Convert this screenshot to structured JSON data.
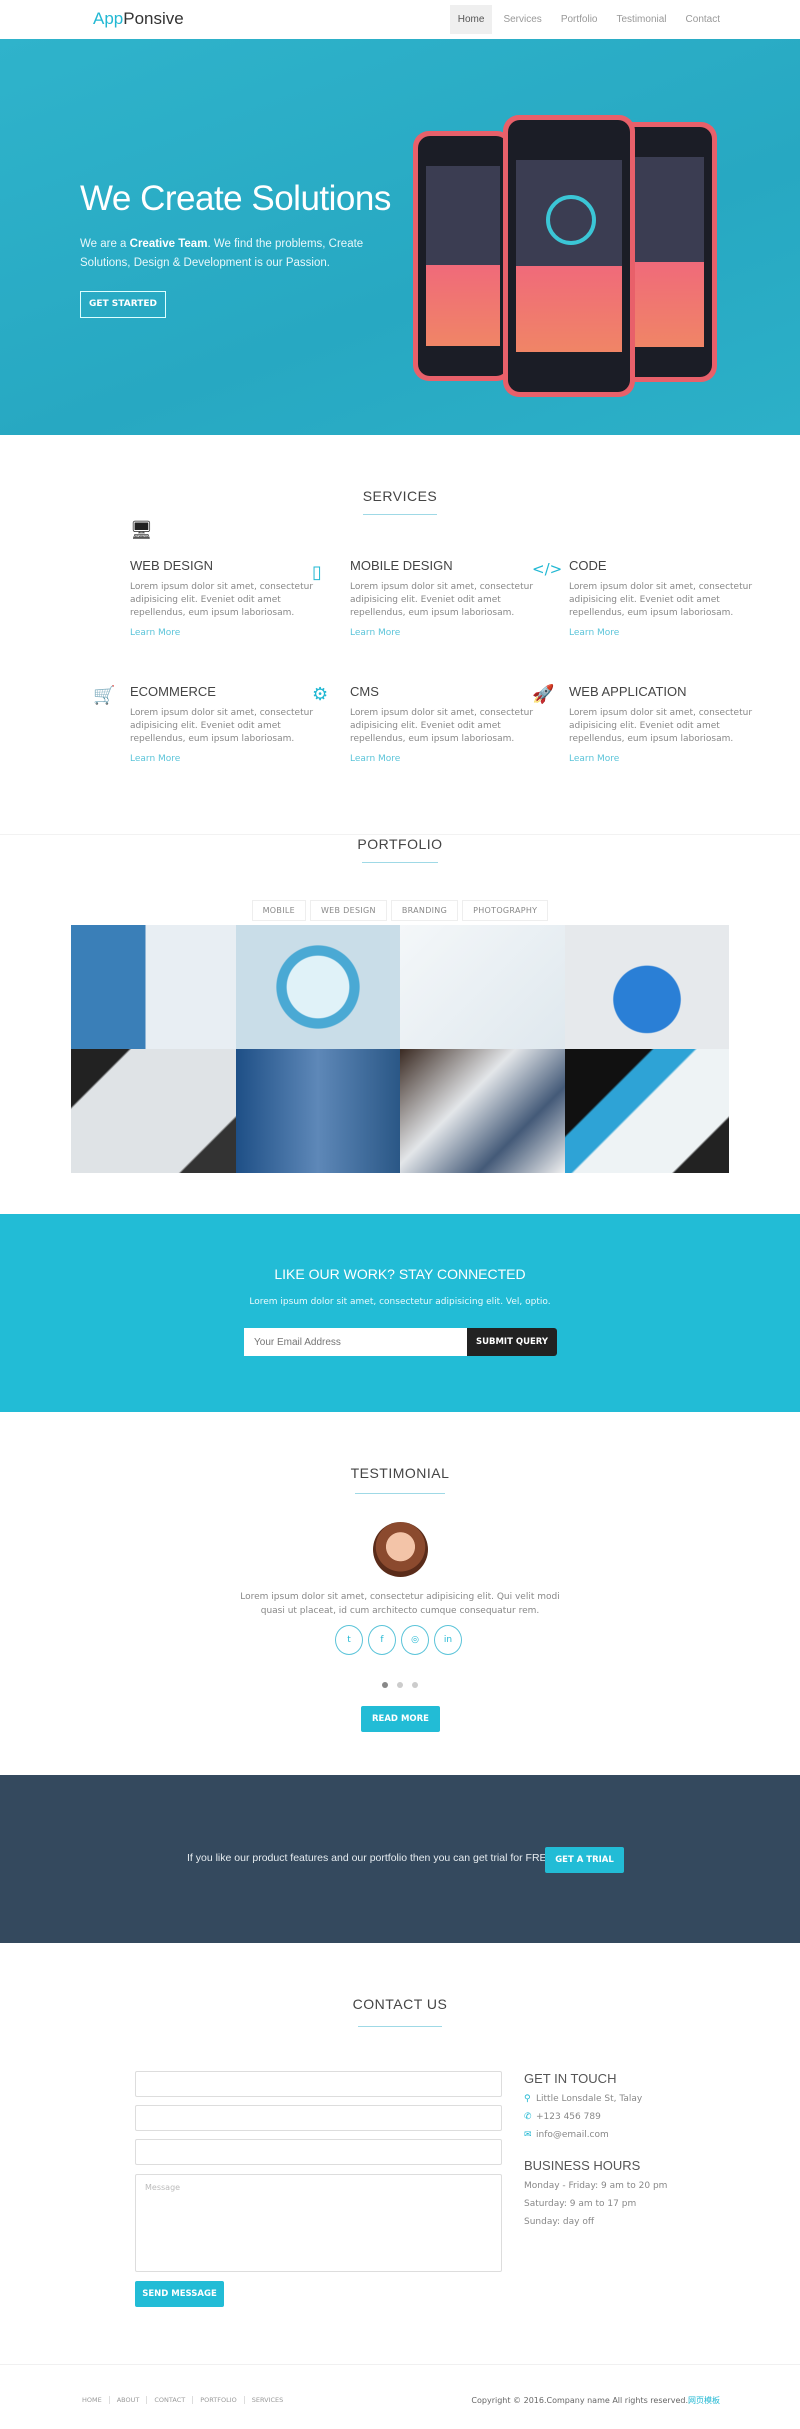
{
  "header": {
    "logo_part1": "App",
    "logo_part2": "Ponsive",
    "nav": [
      "Home",
      "Services",
      "Portfolio",
      "Testimonial",
      "Contact"
    ],
    "active": "Home"
  },
  "hero": {
    "title": "We Create Solutions",
    "text_pre": "We are a ",
    "text_bold": "Creative Team",
    "text_post": ". We find the problems, Create Solutions, Design & Development is our Passion.",
    "button": "GET STARTED"
  },
  "services": {
    "title": "SERVICES",
    "items": [
      {
        "icon": "desktop-icon",
        "title": "WEB DESIGN",
        "text": "Lorem ipsum dolor sit amet, consectetur adipisicing elit. Eveniet odit amet repellendus, eum ipsum laboriosam.",
        "link": "Learn More"
      },
      {
        "icon": "mobile-icon",
        "title": "MOBILE DESIGN",
        "text": "Lorem ipsum dolor sit amet, consectetur adipisicing elit. Eveniet odit amet repellendus, eum ipsum laboriosam.",
        "link": "Learn More"
      },
      {
        "icon": "code-icon",
        "title": "CODE",
        "text": "Lorem ipsum dolor sit amet, consectetur adipisicing elit. Eveniet odit amet repellendus, eum ipsum laboriosam.",
        "link": "Learn More"
      },
      {
        "icon": "cart-icon",
        "title": "ECOMMERCE",
        "text": "Lorem ipsum dolor sit amet, consectetur adipisicing elit. Eveniet odit amet repellendus, eum ipsum laboriosam.",
        "link": "Learn More"
      },
      {
        "icon": "gear-icon",
        "title": "CMS",
        "text": "Lorem ipsum dolor sit amet, consectetur adipisicing elit. Eveniet odit amet repellendus, eum ipsum laboriosam.",
        "link": "Learn More"
      },
      {
        "icon": "rocket-icon",
        "title": "WEB APPLICATION",
        "text": "Lorem ipsum dolor sit amet, consectetur adipisicing elit. Eveniet odit amet repellendus, eum ipsum laboriosam.",
        "link": "Learn More"
      }
    ]
  },
  "portfolio": {
    "title": "PORTFOLIO",
    "filters": [
      "MOBILE",
      "WEB DESIGN",
      "BRANDING",
      "PHOTOGRAPHY"
    ]
  },
  "newsletter": {
    "title": "LIKE OUR WORK? STAY CONNECTED",
    "text": "Lorem ipsum dolor sit amet, consectetur adipisicing elit. Vel, optio.",
    "placeholder": "Your Email Address",
    "button": "SUBMIT QUERY"
  },
  "testimonial": {
    "title": "TESTIMONIAL",
    "quote_line1": "Lorem ipsum dolor sit amet, consectetur adipisicing elit. Qui velit modi",
    "quote_line2": "quasi ut placeat, id cum architecto cumque consequatur rem.",
    "socials": [
      "twitter-icon",
      "facebook-icon",
      "dribbble-icon",
      "linkedin-icon"
    ],
    "social_glyphs": [
      "t",
      "f",
      "◎",
      "in"
    ],
    "slides": 3,
    "active_slide": 1,
    "button": "READ MORE"
  },
  "cta": {
    "text": "If you like our product features and our portfolio then you can get trial for FREE",
    "button": "GET A TRIAL"
  },
  "contact": {
    "title": "CONTACT US",
    "message_placeholder": "Message",
    "button": "SEND MESSAGE",
    "get_in_touch": "GET IN TOUCH",
    "address": "Little Lonsdale St, Talay",
    "phone": "+123 456 789",
    "email": "info@email.com",
    "hours_title": "BUSINESS HOURS",
    "hours": [
      "Monday - Friday: 9 am to 20 pm",
      "Saturday: 9 am to 17 pm",
      "Sunday: day off"
    ]
  },
  "footer": {
    "nav": [
      "HOME",
      "ABOUT",
      "CONTACT",
      "PORTFOLIO",
      "SERVICES"
    ],
    "copyright": "Copyright © 2016.Company name All rights reserved.",
    "copyright_link": "网页模板"
  },
  "colors": {
    "accent": "#22bcd6",
    "dark": "#34495e",
    "submit": "#222222"
  }
}
